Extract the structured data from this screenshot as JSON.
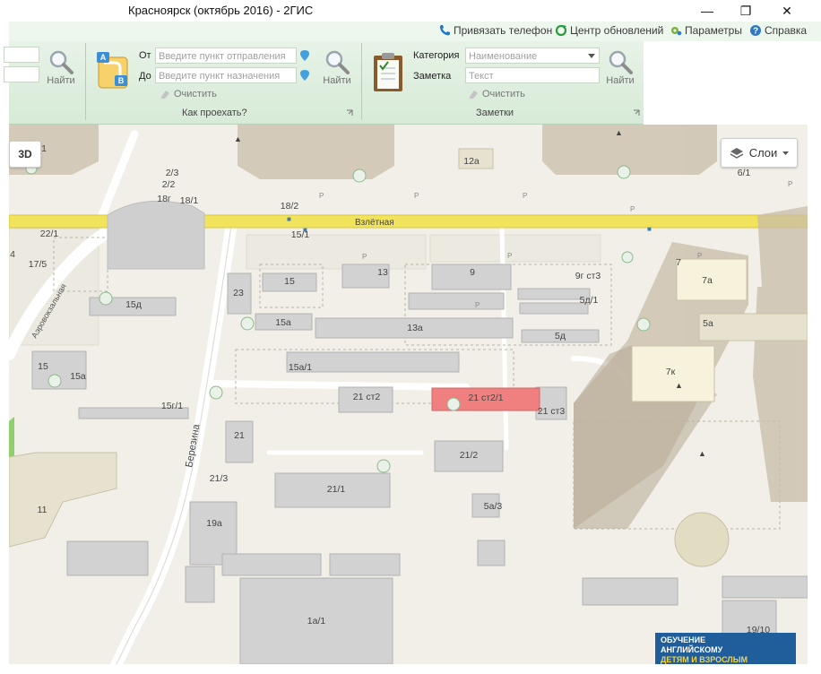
{
  "window": {
    "title": "Красноярск (октябрь 2016) - 2ГИС"
  },
  "topbar": {
    "phone_link": "Привязать телефон",
    "updates_link": "Центр обновлений",
    "params_link": "Параметры",
    "help_link": "Справка"
  },
  "search": {
    "find_label": "Найти"
  },
  "route": {
    "from_label": "От",
    "to_label": "До",
    "from_placeholder": "Введите пункт отправления",
    "to_placeholder": "Введите пункт назначения",
    "find_label": "Найти",
    "clear_label": "Очистить",
    "group_title": "Как проехать?"
  },
  "notes": {
    "category_label": "Категория",
    "note_label": "Заметка",
    "category_placeholder": "Наименование",
    "text_placeholder": "Текст",
    "find_label": "Найти",
    "clear_label": "Очистить",
    "group_title": "Заметки"
  },
  "map": {
    "btn_3d": "3D",
    "layers_label": "Слои",
    "streets": [
      "Взлётная",
      "Березина",
      "Аэровокзальная"
    ],
    "buildings": [
      "1",
      "2/3",
      "2/2",
      "18г",
      "18/1",
      "18/2",
      "15/1",
      "12а",
      "6/1",
      "22/1",
      "4",
      "17/5",
      "15д",
      "15",
      "23",
      "15а",
      "13",
      "9",
      "9г ст3",
      "5д/1",
      "7",
      "7а",
      "5а",
      "5д",
      "13а",
      "15а/1",
      "15",
      "15а",
      "15г/1",
      "21 ст2",
      "21 ст2/1",
      "21 ст3",
      "7к",
      "21",
      "21/2",
      "21/1",
      "21/3",
      "19а",
      "11",
      "5а/3",
      "1а/1",
      "19/10"
    ],
    "highlighted_building": "21 ст2/1",
    "ad_text": [
      "ОБУЧЕНИЕ",
      "АНГЛИЙСКОМУ",
      "ДЕТЯМ И ВЗРОСЛЫМ"
    ]
  },
  "colors": {
    "ribbon": "#dbeddb",
    "map_bg": "#f1efe7",
    "road_main": "#f2e35c",
    "highlight": "#f08080"
  }
}
